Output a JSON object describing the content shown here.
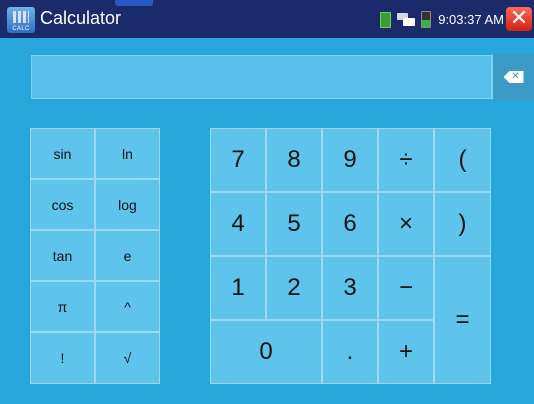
{
  "topbar": {
    "app_icon_caption": "CALC",
    "title": "Calculator",
    "time": "9:03:37 AM"
  },
  "display": {
    "value": ""
  },
  "scientific_keys": [
    {
      "label": "sin"
    },
    {
      "label": "ln"
    },
    {
      "label": "cos"
    },
    {
      "label": "log"
    },
    {
      "label": "tan"
    },
    {
      "label": "e"
    },
    {
      "label": "π"
    },
    {
      "label": "^"
    },
    {
      "label": "!"
    },
    {
      "label": "√"
    }
  ],
  "number_keys": {
    "seven": "7",
    "eight": "8",
    "nine": "9",
    "divide": "÷",
    "open_paren": "(",
    "four": "4",
    "five": "5",
    "six": "6",
    "multiply": "×",
    "close_paren": ")",
    "one": "1",
    "two": "2",
    "three": "3",
    "minus": "−",
    "equals": "=",
    "zero": "0",
    "decimal": ".",
    "plus": "+"
  },
  "colors": {
    "title_bar": "#1b2a6a",
    "background": "#27a6dc",
    "key": "#5ec4ec",
    "close": "#e23a26"
  },
  "icons": [
    "calc-app-icon",
    "sd-card-icon",
    "network-icon",
    "battery-icon",
    "close-icon",
    "backspace-icon"
  ]
}
